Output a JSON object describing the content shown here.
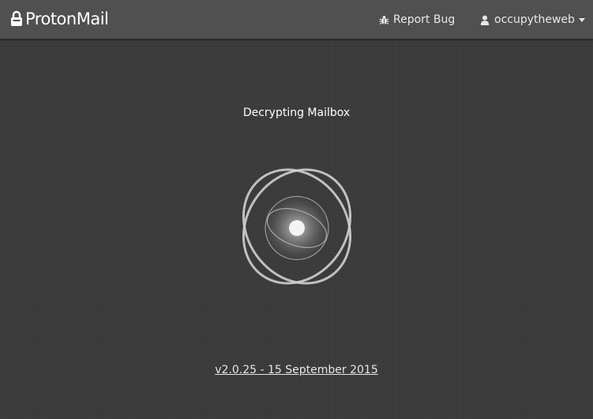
{
  "header": {
    "brand": "ProtonMail",
    "report_bug": "Report Bug",
    "username": "occupytheweb"
  },
  "main": {
    "status": "Decrypting Mailbox",
    "version": "v2.0.25 - 15 September 2015"
  },
  "icons": {
    "brand": "lock-icon",
    "report_bug": "bug-icon",
    "user": "user-icon",
    "dropdown": "caret-down-icon",
    "loader": "atom-loader-icon"
  },
  "colors": {
    "topbar": "#505050",
    "background": "#3b3b3b",
    "text": "#ffffff"
  }
}
